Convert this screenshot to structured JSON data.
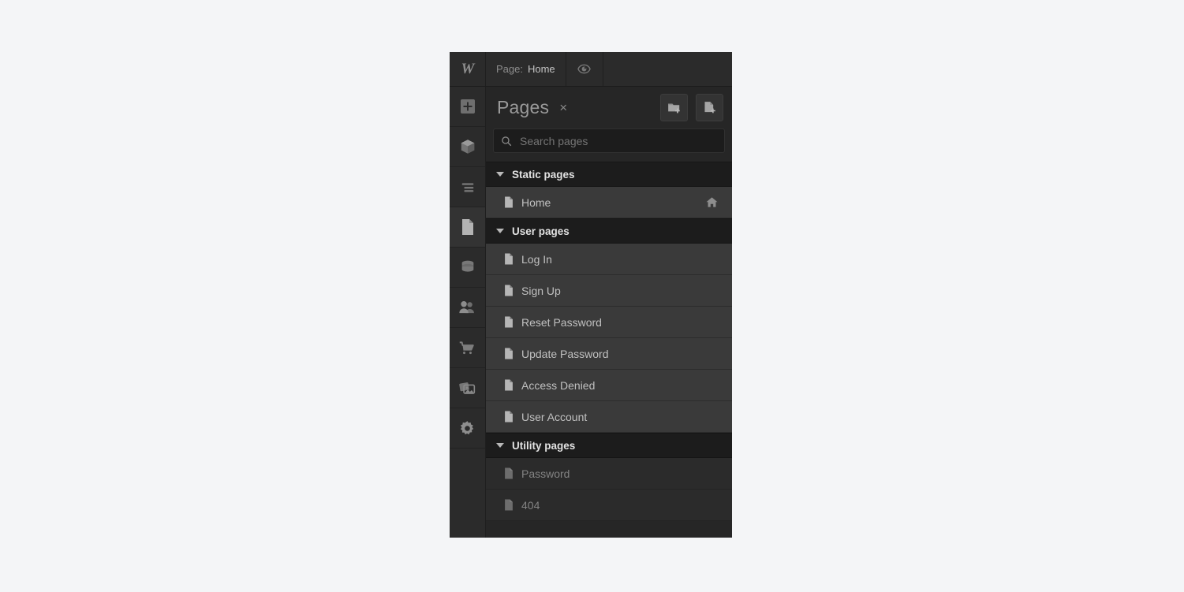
{
  "topbar": {
    "logo_icon": "webflow-w-logo",
    "page_prefix": "Page:",
    "page_name": "Home",
    "preview_icon": "eye-icon"
  },
  "rail": {
    "items": [
      {
        "name": "add-panel",
        "icon": "plus-square-icon",
        "active": false
      },
      {
        "name": "components-panel",
        "icon": "cube-icon",
        "active": false
      },
      {
        "name": "navigator-panel",
        "icon": "layers-lines-icon",
        "active": false
      },
      {
        "name": "pages-panel",
        "icon": "page-document-icon",
        "active": true
      },
      {
        "name": "cms-panel",
        "icon": "database-icon",
        "active": false
      },
      {
        "name": "users-panel",
        "icon": "people-icon",
        "active": false
      },
      {
        "name": "ecommerce-panel",
        "icon": "shopping-cart-icon",
        "active": false
      },
      {
        "name": "assets-panel",
        "icon": "images-icon",
        "active": false
      },
      {
        "name": "settings-panel",
        "icon": "gear-icon",
        "active": false
      }
    ]
  },
  "panel": {
    "title": "Pages",
    "close_label": "×",
    "add_folder_icon": "folder-plus-icon",
    "add_page_icon": "page-plus-icon",
    "search": {
      "placeholder": "Search pages",
      "value": "",
      "icon": "search-icon"
    },
    "sections": [
      {
        "id": "static",
        "title": "Static pages",
        "expanded": true,
        "highlighted": false,
        "pages": [
          {
            "label": "Home",
            "icon": "page-document-icon",
            "right_icon": "home-icon",
            "dim": false
          }
        ]
      },
      {
        "id": "user",
        "title": "User pages",
        "expanded": true,
        "highlighted": true,
        "pages": [
          {
            "label": "Log In",
            "icon": "page-document-icon",
            "right_icon": "",
            "dim": false
          },
          {
            "label": "Sign Up",
            "icon": "page-document-icon",
            "right_icon": "",
            "dim": false
          },
          {
            "label": "Reset Password",
            "icon": "page-document-icon",
            "right_icon": "",
            "dim": false
          },
          {
            "label": "Update Password",
            "icon": "page-document-icon",
            "right_icon": "",
            "dim": false
          },
          {
            "label": "Access Denied",
            "icon": "page-document-icon",
            "right_icon": "",
            "dim": false
          },
          {
            "label": "User Account",
            "icon": "page-document-icon",
            "right_icon": "",
            "dim": false
          }
        ]
      },
      {
        "id": "utility",
        "title": "Utility pages",
        "expanded": true,
        "highlighted": false,
        "pages": [
          {
            "label": "Password",
            "icon": "page-document-icon",
            "right_icon": "",
            "dim": true
          },
          {
            "label": "404",
            "icon": "page-document-icon",
            "right_icon": "",
            "dim": true
          }
        ]
      }
    ]
  },
  "colors": {
    "panel_bg": "#262626",
    "row_bg": "#3a3a3a",
    "row_dim_bg": "#2b2b2b",
    "section_bg": "#1c1c1c",
    "highlight": "#ffffff",
    "canvas_bg": "#f4f5f7"
  }
}
